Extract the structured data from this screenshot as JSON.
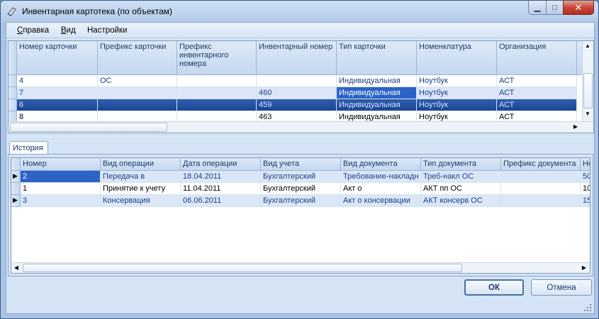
{
  "window": {
    "title": "Инвентарная картотека (по объектам)"
  },
  "menu": [
    {
      "label": "Справка",
      "underline": "С",
      "rest": "правка"
    },
    {
      "label": "Вид",
      "underline": "В",
      "rest": "ид"
    },
    {
      "label": "Настройки"
    }
  ],
  "top_grid": {
    "columns": [
      "Номер карточки",
      "Префикс карточки",
      "Префикс инвентарного номера",
      "Инвентарный номер",
      "Тип карточки",
      "Номенклатура",
      "Организация"
    ],
    "rows": [
      {
        "num": "4",
        "prefix": "ОС",
        "inv_prefix": "",
        "inv_num": "",
        "type": "Индивидуальная",
        "nom": "Ноутбук",
        "org": "АСТ"
      },
      {
        "num": "7",
        "prefix": "",
        "inv_prefix": "",
        "inv_num": "460",
        "type": "Индивидуальная",
        "nom": "Ноутбук",
        "org": "АСТ"
      },
      {
        "num": "6",
        "prefix": "",
        "inv_prefix": "",
        "inv_num": "459",
        "type": "Индивидуальная",
        "nom": "Ноутбук",
        "org": "АСТ"
      },
      {
        "num": "8",
        "prefix": "",
        "inv_prefix": "",
        "inv_num": "463",
        "type": "Индивидуальная",
        "nom": "Ноутбук",
        "org": "АСТ"
      }
    ]
  },
  "history_tab": {
    "label": "История"
  },
  "history_grid": {
    "columns": [
      "Номер",
      "Вид операции",
      "Дата операции",
      "Вид учета",
      "Вид документа",
      "Тип документа",
      "Префикс документа",
      "Но"
    ],
    "rows": [
      {
        "num": "2",
        "op": "Передача в",
        "date": "18.04.2011",
        "acc": "Бухгалтерский",
        "doc": "Требование-накладн",
        "doctype": "Треб-накл ОС",
        "prefix": "",
        "extra": "50"
      },
      {
        "num": "1",
        "op": "Принятие к учету",
        "date": "11.04.2011",
        "acc": "Бухгалтерский",
        "doc": "Акт о",
        "doctype": "АКТ пп ОС",
        "prefix": "",
        "extra": "10"
      },
      {
        "num": "3",
        "op": "Консервация",
        "date": "06.06.2011",
        "acc": "Бухгалтерский",
        "doc": "Акт о консервации",
        "doctype": "АКТ консерв ОС",
        "prefix": "",
        "extra": "15"
      }
    ]
  },
  "buttons": {
    "ok": "ОК",
    "cancel": "Отмена"
  },
  "colors": {
    "selected_row": "#1f4fa0",
    "alt_row": "#dbe6f7",
    "header_text": "#1e3a6b"
  }
}
